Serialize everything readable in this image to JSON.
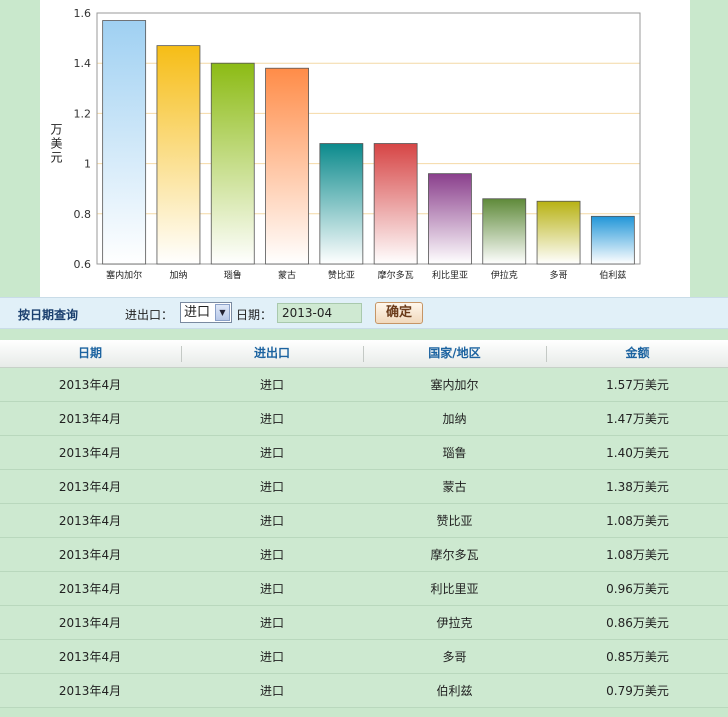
{
  "chart_data": {
    "type": "bar",
    "ylabel": "万美元",
    "ylim": [
      0.6,
      1.6
    ],
    "yticks": [
      "0.6",
      "0.8",
      "1",
      "1.2",
      "1.4",
      "1.6"
    ],
    "categories": [
      "塞内加尔",
      "加纳",
      "瑙鲁",
      "蒙古",
      "赞比亚",
      "摩尔多瓦",
      "利比里亚",
      "伊拉克",
      "多哥",
      "伯利兹"
    ],
    "values": [
      1.57,
      1.47,
      1.4,
      1.38,
      1.08,
      1.08,
      0.96,
      0.86,
      0.85,
      0.79
    ],
    "colors": [
      "#9fd0f2",
      "#f6bd16",
      "#8cbb14",
      "#ff8c48",
      "#0b8a8c",
      "#d64545",
      "#8a3f8c",
      "#5f8a3a",
      "#b8b214",
      "#2196d8"
    ],
    "grid": true,
    "legend": "none"
  },
  "query": {
    "title": "按日期查询",
    "direction_label": "进出口：",
    "direction_value": "进口",
    "date_label": "日期：",
    "date_value": "2013-04",
    "confirm_label": "确定"
  },
  "table": {
    "headers": [
      "日期",
      "进出口",
      "国家/地区",
      "金额"
    ],
    "rows": [
      [
        "2013年4月",
        "进口",
        "塞内加尔",
        "1.57万美元"
      ],
      [
        "2013年4月",
        "进口",
        "加纳",
        "1.47万美元"
      ],
      [
        "2013年4月",
        "进口",
        "瑙鲁",
        "1.40万美元"
      ],
      [
        "2013年4月",
        "进口",
        "蒙古",
        "1.38万美元"
      ],
      [
        "2013年4月",
        "进口",
        "赞比亚",
        "1.08万美元"
      ],
      [
        "2013年4月",
        "进口",
        "摩尔多瓦",
        "1.08万美元"
      ],
      [
        "2013年4月",
        "进口",
        "利比里亚",
        "0.96万美元"
      ],
      [
        "2013年4月",
        "进口",
        "伊拉克",
        "0.86万美元"
      ],
      [
        "2013年4月",
        "进口",
        "多哥",
        "0.85万美元"
      ],
      [
        "2013年4月",
        "进口",
        "伯利兹",
        "0.79万美元"
      ]
    ]
  }
}
